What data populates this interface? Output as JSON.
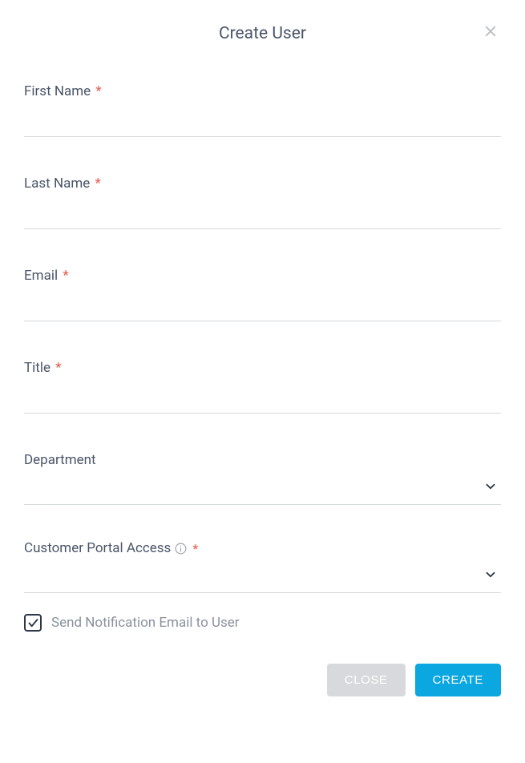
{
  "dialog": {
    "title": "Create User"
  },
  "fields": {
    "first_name": {
      "label": "First Name",
      "required": true,
      "value": ""
    },
    "last_name": {
      "label": "Last Name",
      "required": true,
      "value": ""
    },
    "email": {
      "label": "Email",
      "required": true,
      "value": ""
    },
    "title": {
      "label": "Title",
      "required": true,
      "value": ""
    },
    "department": {
      "label": "Department",
      "required": false,
      "value": ""
    },
    "portal_access": {
      "label": "Customer Portal Access",
      "required": true,
      "value": ""
    }
  },
  "checkbox": {
    "send_notification": {
      "label": "Send Notification Email to User",
      "checked": true
    }
  },
  "actions": {
    "close": "CLOSE",
    "create": "CREATE"
  },
  "required_marker": "*"
}
